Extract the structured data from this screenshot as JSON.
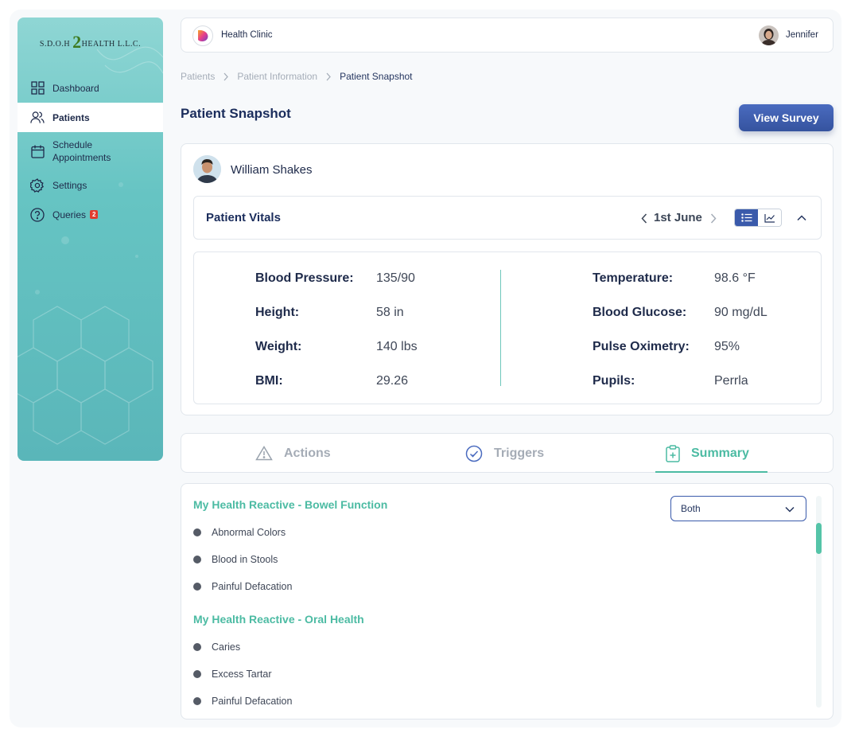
{
  "sidebar": {
    "logo": {
      "prefix": "S.D.O.H",
      "number": "2",
      "suffix": "HEALTH L.L.C."
    },
    "items": [
      {
        "id": "dashboard",
        "label": "Dashboard",
        "icon": "grid-icon"
      },
      {
        "id": "patients",
        "label": "Patients",
        "icon": "users-icon",
        "active": true
      },
      {
        "id": "schedule",
        "label": "Schedule Appointments",
        "icon": "calendar-icon"
      },
      {
        "id": "settings",
        "label": "Settings",
        "icon": "gear-icon"
      },
      {
        "id": "queries",
        "label": "Queries",
        "icon": "help-circle-icon",
        "badge": "2"
      }
    ]
  },
  "topbar": {
    "app_name": "Health Clinic",
    "user_name": "Jennifer"
  },
  "breadcrumb": {
    "items": [
      "Patients",
      "Patient Information",
      "Patient Snapshot"
    ]
  },
  "page": {
    "title": "Patient Snapshot",
    "view_survey_label": "View Survey"
  },
  "patient": {
    "name": "William Shakes"
  },
  "vitals": {
    "title": "Patient Vitals",
    "date": "1st June",
    "left": [
      {
        "label": "Blood Pressure:",
        "value": "135/90"
      },
      {
        "label": "Height:",
        "value": "58 in"
      },
      {
        "label": "Weight:",
        "value": "140 lbs"
      },
      {
        "label": "BMI:",
        "value": "29.26"
      }
    ],
    "right": [
      {
        "label": "Temperature:",
        "value": "98.6 °F"
      },
      {
        "label": "Blood Glucose:",
        "value": "90 mg/dL"
      },
      {
        "label": "Pulse Oximetry:",
        "value": "95%"
      },
      {
        "label": "Pupils:",
        "value": "Perrla"
      }
    ]
  },
  "tabs": [
    {
      "label": "Actions",
      "icon": "warning-triangle-icon"
    },
    {
      "label": "Triggers",
      "icon": "check-circle-icon"
    },
    {
      "label": "Summary",
      "icon": "clipboard-plus-icon",
      "active": true
    }
  ],
  "summary": {
    "filter": {
      "selected": "Both"
    },
    "sections": [
      {
        "title": "My Health Reactive - Bowel Function",
        "items": [
          "Abnormal Colors",
          "Blood in Stools",
          "Painful Defacation"
        ]
      },
      {
        "title": "My Health Reactive - Oral Health",
        "items": [
          "Caries",
          "Excess Tartar",
          "Painful Defacation"
        ]
      }
    ]
  },
  "colors": {
    "accent": "#4cbba3",
    "primary": "#3a5aab",
    "navy": "#1b2d5c",
    "sidebar": "#66c4c3",
    "badge": "#e23b2e"
  }
}
